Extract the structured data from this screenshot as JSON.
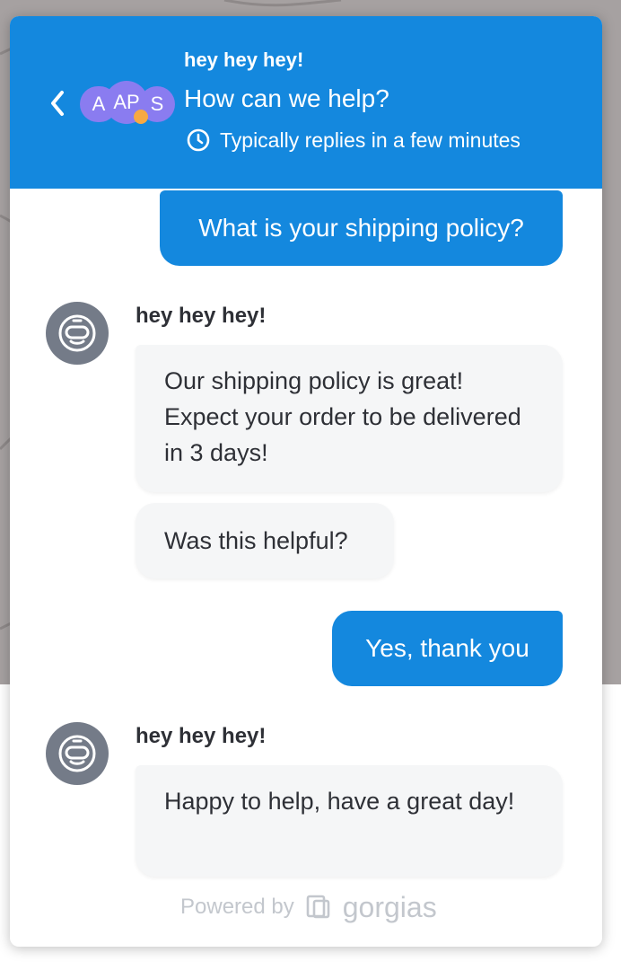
{
  "header": {
    "brand_name": "hey hey hey!",
    "title": "How can we help?",
    "reply_time": "Typically replies in a few minutes",
    "avatars": [
      "A",
      "AP",
      "S"
    ],
    "back_icon": "chevron-left-icon",
    "clock_icon": "clock-icon"
  },
  "messages": [
    {
      "from": "customer",
      "text": "What is your shipping policy?"
    },
    {
      "from": "bot",
      "sender": "hey hey hey!",
      "text": "Our shipping policy is great! Expect your order to be delivered in 3 days!"
    },
    {
      "from": "bot",
      "text": "Was this helpful?"
    },
    {
      "from": "customer",
      "text": "Yes, thank you"
    },
    {
      "from": "bot",
      "sender": "hey hey hey!",
      "text": "Happy to help, have a great day!"
    }
  ],
  "footer": {
    "powered_by": "Powered by",
    "brand": "gorgias"
  },
  "colors": {
    "header_bg": "#1488de",
    "customer_bubble": "#1488de",
    "bot_bubble": "#f5f6f7",
    "avatar_bg": "#8a7cf0",
    "online_dot": "#f7a942"
  }
}
